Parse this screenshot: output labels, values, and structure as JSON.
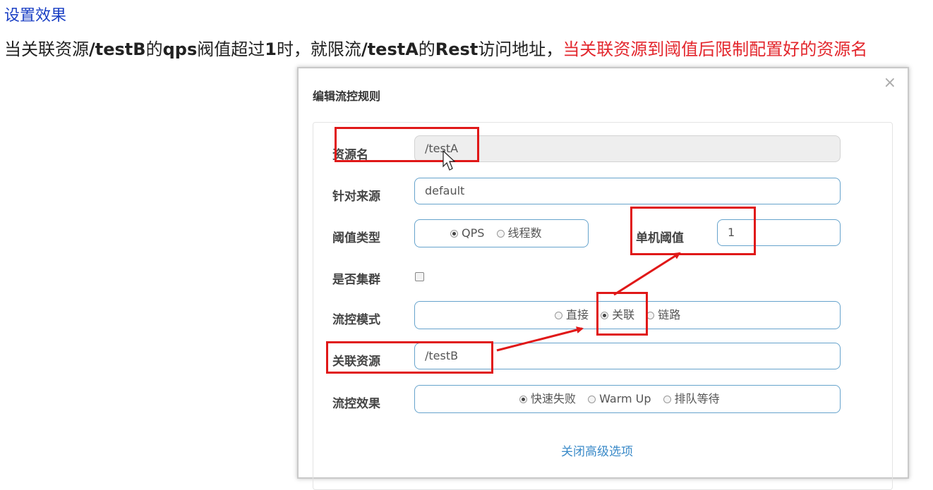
{
  "heading": "设置效果",
  "description": {
    "seg1": "当关联资源",
    "seg2": "/testB",
    "seg3": "的",
    "seg4": "qps",
    "seg5": "阀值超过",
    "seg6": "1",
    "seg7": "时，就限流",
    "seg8": "/testA",
    "seg9": "的",
    "seg10": "Rest",
    "seg11": "访问地址，",
    "red": "当关联资源到阈值后限制配置好的资源名"
  },
  "modal": {
    "title": "编辑流控规则",
    "close": "×",
    "resource_name": {
      "label": "资源名",
      "value": "/testA"
    },
    "limit_app": {
      "label": "针对来源",
      "value": "default"
    },
    "threshold_type": {
      "label": "阈值类型",
      "options": [
        "QPS",
        "线程数"
      ],
      "selected": "QPS"
    },
    "single_threshold": {
      "label": "单机阈值",
      "value": "1"
    },
    "cluster": {
      "label": "是否集群",
      "checked": false
    },
    "strategy": {
      "label": "流控模式",
      "options": [
        "直接",
        "关联",
        "链路"
      ],
      "selected": "关联"
    },
    "ref_resource": {
      "label": "关联资源",
      "value": "/testB"
    },
    "control_behavior": {
      "label": "流控效果",
      "options": [
        "快速失败",
        "Warm Up",
        "排队等待"
      ],
      "selected": "快速失败"
    },
    "advanced_link": "关闭高级选项"
  },
  "annotation_color": "#e01818"
}
